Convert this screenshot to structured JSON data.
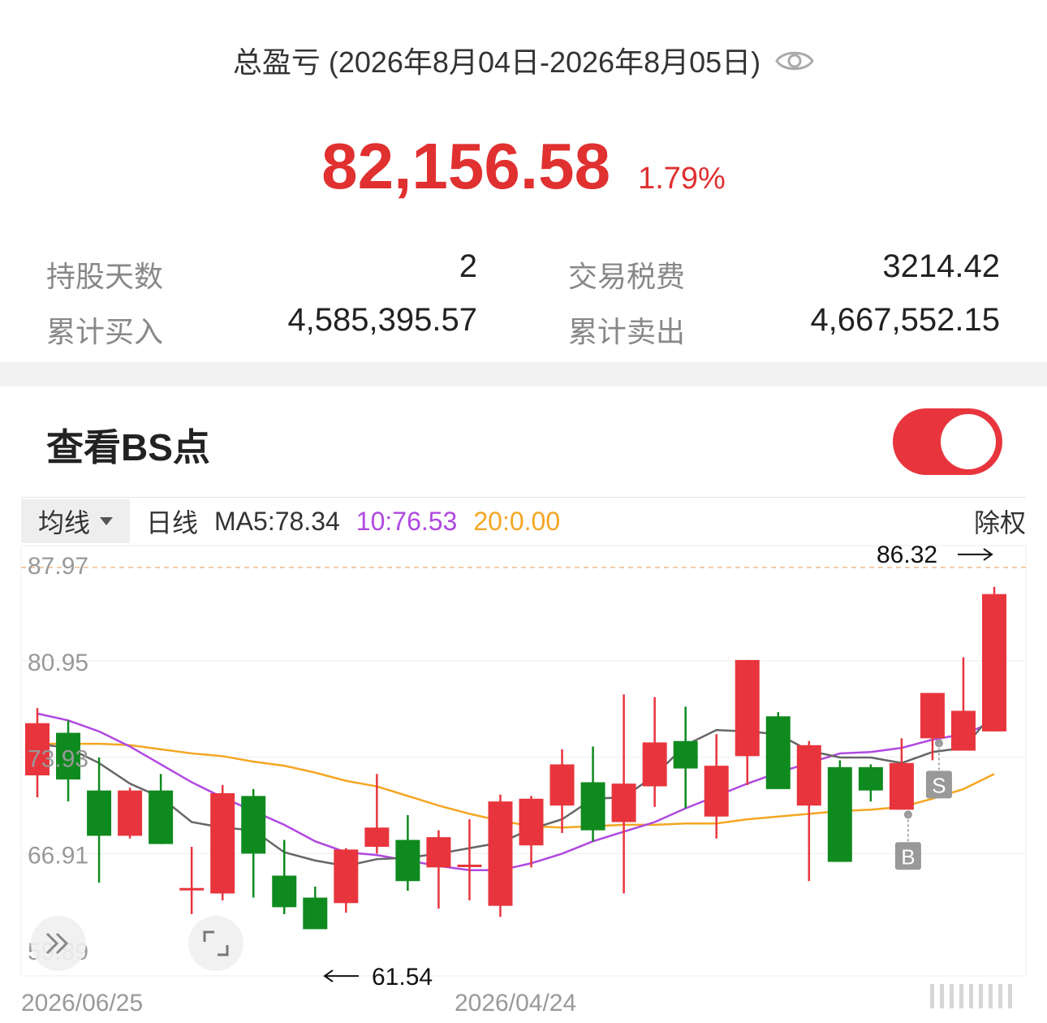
{
  "summary": {
    "title": "总盈亏 (2026年8月04日-2026年8月05日)",
    "eye_icon": "eye-icon",
    "pnl_value": "82,156.58",
    "pnl_pct": "1.79%",
    "accent_color": "#e03030",
    "stats": {
      "hold_days_label": "持股天数",
      "hold_days_value": "2",
      "fees_label": "交易税费",
      "fees_value": "3214.42",
      "total_buy_label": "累计买入",
      "total_buy_value": "4,585,395.57",
      "total_sell_label": "累计卖出",
      "total_sell_value": "4,667,552.15"
    }
  },
  "bs_section": {
    "title": "查看BS点",
    "toggle_on": true
  },
  "toolbar": {
    "ma_dropdown_label": "均线",
    "period_label": "日线",
    "ma5": "MA5:78.34",
    "ma10": "10:76.53",
    "ma20": "20:0.00",
    "adjust_label": "除权",
    "colors": {
      "ma5": "#666666",
      "ma10": "#b048e0",
      "ma20": "#f5a623"
    }
  },
  "chart_data": {
    "type": "candlestick",
    "y_ticks": [
      "87.97",
      "80.95",
      "73.93",
      "66.91",
      "59.89"
    ],
    "ylim": [
      59.89,
      87.97
    ],
    "x_labels": [
      "2026/06/25",
      "2026/04/24"
    ],
    "high_marker": "86.32",
    "low_marker": "61.54",
    "up_color": "#e8353d",
    "down_color": "#0f8a1f",
    "candles": [
      {
        "o": 72.6,
        "h": 77.5,
        "l": 71.0,
        "c": 76.4
      },
      {
        "o": 75.7,
        "h": 76.6,
        "l": 70.7,
        "c": 72.3
      },
      {
        "o": 71.5,
        "h": 73.9,
        "l": 64.8,
        "c": 68.2
      },
      {
        "o": 68.2,
        "h": 71.7,
        "l": 68.0,
        "c": 71.5
      },
      {
        "o": 71.5,
        "h": 72.7,
        "l": 67.6,
        "c": 67.6
      },
      {
        "o": 64.4,
        "h": 67.4,
        "l": 62.5,
        "c": 64.4
      },
      {
        "o": 64.0,
        "h": 71.9,
        "l": 63.5,
        "c": 71.3
      },
      {
        "o": 71.1,
        "h": 71.6,
        "l": 63.7,
        "c": 66.9
      },
      {
        "o": 65.3,
        "h": 67.9,
        "l": 62.5,
        "c": 63.0
      },
      {
        "o": 63.7,
        "h": 64.5,
        "l": 61.54,
        "c": 61.4
      },
      {
        "o": 63.3,
        "h": 67.3,
        "l": 62.6,
        "c": 67.2
      },
      {
        "o": 67.4,
        "h": 72.7,
        "l": 66.9,
        "c": 68.8
      },
      {
        "o": 67.9,
        "h": 69.7,
        "l": 64.2,
        "c": 64.9
      },
      {
        "o": 65.9,
        "h": 68.6,
        "l": 62.9,
        "c": 68.1
      },
      {
        "o": 66.1,
        "h": 69.4,
        "l": 63.5,
        "c": 66.1
      },
      {
        "o": 63.1,
        "h": 71.2,
        "l": 62.3,
        "c": 70.7
      },
      {
        "o": 67.5,
        "h": 71.1,
        "l": 65.9,
        "c": 70.9
      },
      {
        "o": 70.4,
        "h": 74.5,
        "l": 68.4,
        "c": 73.4
      },
      {
        "o": 72.1,
        "h": 74.7,
        "l": 67.8,
        "c": 68.6
      },
      {
        "o": 69.2,
        "h": 78.5,
        "l": 64.0,
        "c": 72.0
      },
      {
        "o": 71.8,
        "h": 78.3,
        "l": 70.3,
        "c": 75.0
      },
      {
        "o": 75.1,
        "h": 77.6,
        "l": 70.2,
        "c": 73.1
      },
      {
        "o": 69.6,
        "h": 75.6,
        "l": 68.0,
        "c": 73.3
      },
      {
        "o": 74.0,
        "h": 81.0,
        "l": 71.9,
        "c": 81.0
      },
      {
        "o": 76.9,
        "h": 77.2,
        "l": 71.7,
        "c": 71.6
      },
      {
        "o": 70.4,
        "h": 75.1,
        "l": 64.9,
        "c": 74.8
      },
      {
        "o": 73.2,
        "h": 73.7,
        "l": 66.3,
        "c": 66.3
      },
      {
        "o": 73.2,
        "h": 73.4,
        "l": 70.7,
        "c": 71.5
      },
      {
        "o": 70.1,
        "h": 75.3,
        "l": 70.1,
        "c": 73.5
      },
      {
        "o": 75.3,
        "h": 78.6,
        "l": 73.7,
        "c": 78.6
      },
      {
        "o": 74.4,
        "h": 81.2,
        "l": 74.4,
        "c": 77.3
      },
      {
        "o": 75.8,
        "h": 86.32,
        "l": 75.8,
        "c": 85.8
      }
    ],
    "ma5_series": [
      74.9,
      74.6,
      73.5,
      72.0,
      71.0,
      69.2,
      68.8,
      68.6,
      67.0,
      66.4,
      66.0,
      66.5,
      66.6,
      66.9,
      67.3,
      67.7,
      68.7,
      69.4,
      70.9,
      71.0,
      72.6,
      74.8,
      75.9,
      75.8,
      75.6,
      74.4,
      73.9,
      73.9,
      73.5,
      74.3,
      74.6,
      77.2
    ],
    "ma10_series": [
      77.1,
      76.6,
      75.8,
      74.7,
      73.4,
      72.1,
      71.0,
      70.0,
      69.0,
      67.8,
      67.0,
      66.8,
      66.4,
      66.0,
      65.7,
      65.7,
      66.2,
      66.9,
      67.8,
      68.5,
      69.2,
      70.2,
      71.1,
      72.0,
      72.8,
      73.5,
      74.2,
      74.3,
      74.6,
      75.2,
      75.6,
      76.5
    ],
    "ma20_series": [
      74.9,
      74.9,
      74.9,
      74.8,
      74.5,
      74.2,
      74.0,
      73.6,
      73.3,
      72.8,
      72.2,
      71.8,
      71.1,
      70.4,
      69.8,
      69.3,
      68.9,
      68.8,
      68.9,
      69.0,
      69.0,
      69.1,
      69.1,
      69.4,
      69.6,
      69.8,
      70.0,
      70.1,
      70.3,
      70.9,
      71.6,
      72.7
    ],
    "bs_marks": [
      {
        "index": 28,
        "label": "B"
      },
      {
        "index": 29,
        "label": "S"
      }
    ]
  }
}
